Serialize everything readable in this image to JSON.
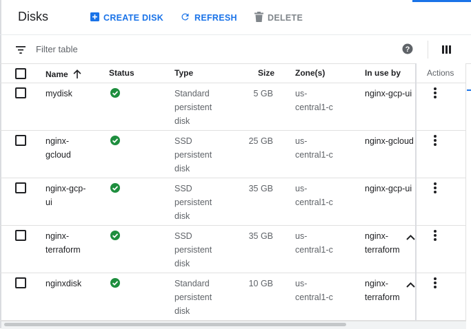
{
  "header": {
    "title": "Disks",
    "create_label": "CREATE DISK",
    "refresh_label": "REFRESH",
    "delete_label": "DELETE"
  },
  "filter": {
    "placeholder": "Filter table"
  },
  "columns": {
    "name": "Name",
    "status": "Status",
    "type": "Type",
    "size": "Size",
    "zones": "Zone(s)",
    "in_use_by": "In use by",
    "actions": "Actions"
  },
  "sort": {
    "column": "Name",
    "direction": "ascending"
  },
  "rows": [
    {
      "name": [
        "mydisk"
      ],
      "status": "ready",
      "type": [
        "Standard",
        "persistent",
        "disk"
      ],
      "size": "5 GB",
      "zone": [
        "us-",
        "central1-c"
      ],
      "in_use": [
        "nginx-gcp-ui"
      ],
      "expandable": false
    },
    {
      "name": [
        "nginx-",
        "gcloud"
      ],
      "status": "ready",
      "type": [
        "SSD",
        "persistent",
        "disk"
      ],
      "size": "25 GB",
      "zone": [
        "us-",
        "central1-c"
      ],
      "in_use": [
        "nginx-gcloud"
      ],
      "expandable": false
    },
    {
      "name": [
        "nginx-gcp-",
        "ui"
      ],
      "status": "ready",
      "type": [
        "SSD",
        "persistent",
        "disk"
      ],
      "size": "35 GB",
      "zone": [
        "us-",
        "central1-c"
      ],
      "in_use": [
        "nginx-gcp-ui"
      ],
      "expandable": false
    },
    {
      "name": [
        "nginx-",
        "terraform"
      ],
      "status": "ready",
      "type": [
        "SSD",
        "persistent",
        "disk"
      ],
      "size": "35 GB",
      "zone": [
        "us-",
        "central1-c"
      ],
      "in_use": [
        "nginx-",
        "terraform"
      ],
      "expandable": true
    },
    {
      "name": [
        "nginxdisk"
      ],
      "status": "ready",
      "type": [
        "Standard",
        "persistent",
        "disk"
      ],
      "size": "10 GB",
      "zone": [
        "us-",
        "central1-c"
      ],
      "in_use": [
        "nginx-",
        "terraform"
      ],
      "expandable": true
    }
  ],
  "icons": {
    "create": "add-box-icon",
    "refresh": "refresh-icon",
    "delete": "trash-icon",
    "filter": "filter-icon",
    "help": "help-icon",
    "columns": "column-display-icon",
    "sort": "arrow-up-icon",
    "status_ok": "check-circle-icon",
    "expand": "chevron-up-icon",
    "row_menu": "more-vert-icon"
  },
  "colors": {
    "accent": "#1a73e8",
    "status_ok": "#1e8e3e",
    "disabled": "#80868b"
  }
}
